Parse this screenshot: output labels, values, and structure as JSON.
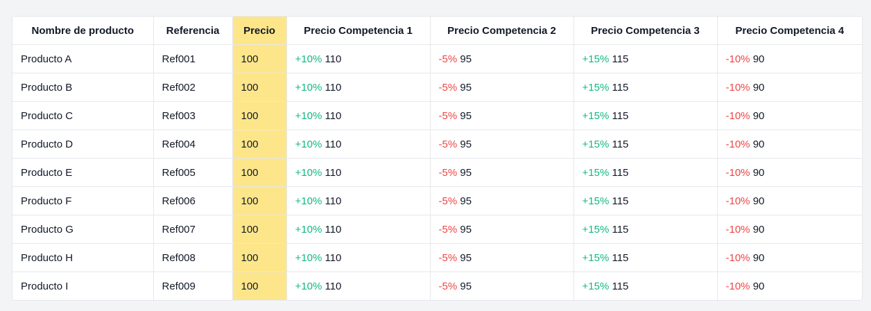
{
  "colors": {
    "positive": "#10b981",
    "negative": "#ef4444",
    "price_highlight": "#fde68a"
  },
  "table": {
    "headers": [
      "Nombre de producto",
      "Referencia",
      "Precio",
      "Precio Competencia 1",
      "Precio Competencia 2",
      "Precio Competencia 3",
      "Precio Competencia 4"
    ],
    "rows": [
      {
        "name": "Producto A",
        "ref": "Ref001",
        "price": "100",
        "c": [
          {
            "delta": "+10%",
            "value": "110",
            "sign": "pos"
          },
          {
            "delta": "-5%",
            "value": "95",
            "sign": "neg"
          },
          {
            "delta": "+15%",
            "value": "115",
            "sign": "pos"
          },
          {
            "delta": "-10%",
            "value": "90",
            "sign": "neg"
          }
        ]
      },
      {
        "name": "Producto B",
        "ref": "Ref002",
        "price": "100",
        "c": [
          {
            "delta": "+10%",
            "value": "110",
            "sign": "pos"
          },
          {
            "delta": "-5%",
            "value": "95",
            "sign": "neg"
          },
          {
            "delta": "+15%",
            "value": "115",
            "sign": "pos"
          },
          {
            "delta": "-10%",
            "value": "90",
            "sign": "neg"
          }
        ]
      },
      {
        "name": "Producto C",
        "ref": "Ref003",
        "price": "100",
        "c": [
          {
            "delta": "+10%",
            "value": "110",
            "sign": "pos"
          },
          {
            "delta": "-5%",
            "value": "95",
            "sign": "neg"
          },
          {
            "delta": "+15%",
            "value": "115",
            "sign": "pos"
          },
          {
            "delta": "-10%",
            "value": "90",
            "sign": "neg"
          }
        ]
      },
      {
        "name": "Producto D",
        "ref": "Ref004",
        "price": "100",
        "c": [
          {
            "delta": "+10%",
            "value": "110",
            "sign": "pos"
          },
          {
            "delta": "-5%",
            "value": "95",
            "sign": "neg"
          },
          {
            "delta": "+15%",
            "value": "115",
            "sign": "pos"
          },
          {
            "delta": "-10%",
            "value": "90",
            "sign": "neg"
          }
        ]
      },
      {
        "name": "Producto E",
        "ref": "Ref005",
        "price": "100",
        "c": [
          {
            "delta": "+10%",
            "value": "110",
            "sign": "pos"
          },
          {
            "delta": "-5%",
            "value": "95",
            "sign": "neg"
          },
          {
            "delta": "+15%",
            "value": "115",
            "sign": "pos"
          },
          {
            "delta": "-10%",
            "value": "90",
            "sign": "neg"
          }
        ]
      },
      {
        "name": "Producto F",
        "ref": "Ref006",
        "price": "100",
        "c": [
          {
            "delta": "+10%",
            "value": "110",
            "sign": "pos"
          },
          {
            "delta": "-5%",
            "value": "95",
            "sign": "neg"
          },
          {
            "delta": "+15%",
            "value": "115",
            "sign": "pos"
          },
          {
            "delta": "-10%",
            "value": "90",
            "sign": "neg"
          }
        ]
      },
      {
        "name": "Producto G",
        "ref": "Ref007",
        "price": "100",
        "c": [
          {
            "delta": "+10%",
            "value": "110",
            "sign": "pos"
          },
          {
            "delta": "-5%",
            "value": "95",
            "sign": "neg"
          },
          {
            "delta": "+15%",
            "value": "115",
            "sign": "pos"
          },
          {
            "delta": "-10%",
            "value": "90",
            "sign": "neg"
          }
        ]
      },
      {
        "name": "Producto H",
        "ref": "Ref008",
        "price": "100",
        "c": [
          {
            "delta": "+10%",
            "value": "110",
            "sign": "pos"
          },
          {
            "delta": "-5%",
            "value": "95",
            "sign": "neg"
          },
          {
            "delta": "+15%",
            "value": "115",
            "sign": "pos"
          },
          {
            "delta": "-10%",
            "value": "90",
            "sign": "neg"
          }
        ]
      },
      {
        "name": "Producto I",
        "ref": "Ref009",
        "price": "100",
        "c": [
          {
            "delta": "+10%",
            "value": "110",
            "sign": "pos"
          },
          {
            "delta": "-5%",
            "value": "95",
            "sign": "neg"
          },
          {
            "delta": "+15%",
            "value": "115",
            "sign": "pos"
          },
          {
            "delta": "-10%",
            "value": "90",
            "sign": "neg"
          }
        ]
      }
    ]
  }
}
